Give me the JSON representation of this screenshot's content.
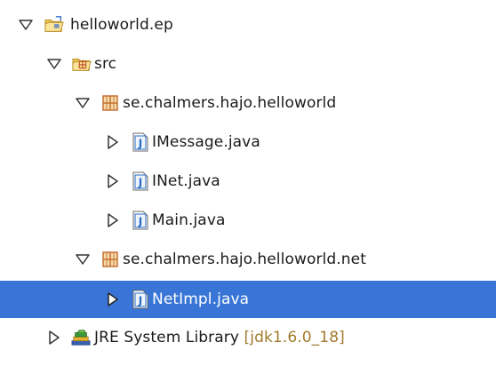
{
  "tree": {
    "project": {
      "label": "helloworld.ep",
      "icon": "project-folder-icon",
      "expanded": true
    },
    "src": {
      "label": "src",
      "icon": "source-folder-icon",
      "expanded": true
    },
    "package1": {
      "label": "se.chalmers.hajo.helloworld",
      "icon": "package-icon",
      "expanded": true
    },
    "file_imessage": {
      "label": "IMessage.java",
      "icon": "java-file-icon",
      "expanded": false
    },
    "file_inet": {
      "label": "INet.java",
      "icon": "java-file-icon",
      "expanded": false
    },
    "file_main": {
      "label": "Main.java",
      "icon": "java-file-icon",
      "expanded": false
    },
    "package2": {
      "label": "se.chalmers.hajo.helloworld.net",
      "icon": "package-icon",
      "expanded": true
    },
    "file_netimpl": {
      "label": "NetImpl.java",
      "icon": "java-file-icon",
      "expanded": false,
      "selected": true
    },
    "jre": {
      "label": "JRE System Library",
      "decoration": "[jdk1.6.0_18]",
      "icon": "library-icon",
      "expanded": false
    }
  },
  "colors": {
    "selection": "#3875d7",
    "decoration": "#a07a2a",
    "java_icon": "#2a6cc4",
    "folder": "#e8b442",
    "package": "#c8843a"
  }
}
